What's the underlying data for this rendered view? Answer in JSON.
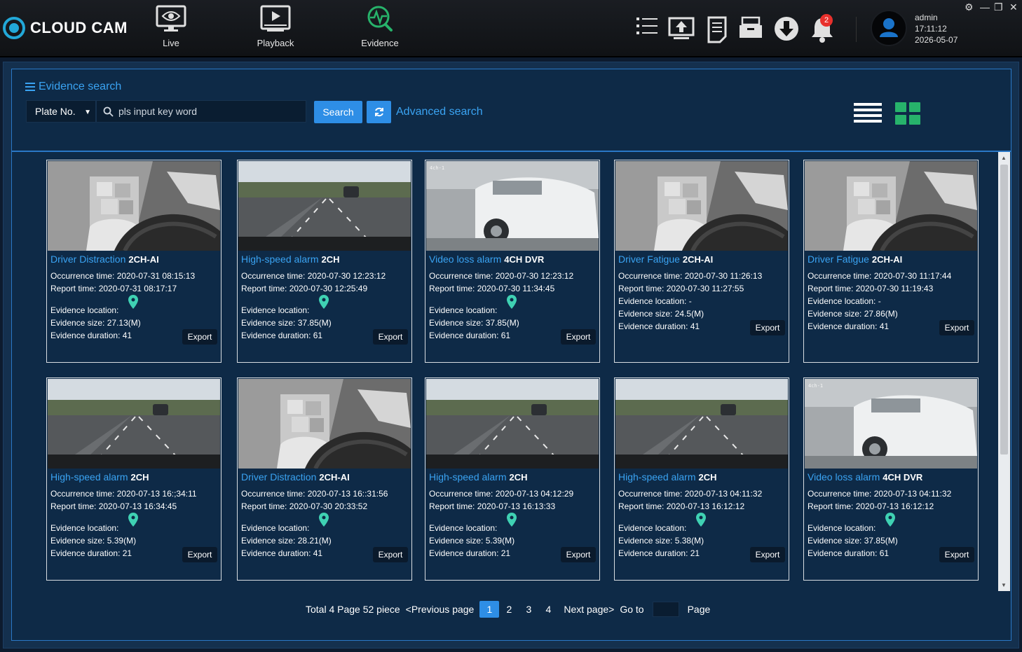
{
  "app": {
    "name": "CLOUD CAM",
    "nav": [
      {
        "label": "Live"
      },
      {
        "label": "Playback"
      },
      {
        "label": "Evidence"
      }
    ],
    "notifications_count": "2",
    "user": {
      "name": "admin",
      "time": "17:11:12",
      "date": "2026-05-07"
    },
    "accent_color": "#2e8ee6",
    "active_nav_color": "#27b36b"
  },
  "search": {
    "title": "Evidence search",
    "field_select": "Plate No.",
    "keyword_placeholder": "pls input key word",
    "search_label": "Search",
    "advanced_label": "Advanced search"
  },
  "labels": {
    "occurrence": "Occurrence time:",
    "report": "Report time:",
    "location": "Evidence location:",
    "size": "Evidence size:",
    "duration": "Evidence duration:",
    "export": "Export"
  },
  "cards": [
    {
      "type": "Driver Distraction",
      "channel": "2CH-AI",
      "occurrence": "2020-07-31 08:15:13",
      "report": "2020-07-31 08:17:17",
      "location": "",
      "size": "27.13(M)",
      "duration": "41",
      "image": "cabin"
    },
    {
      "type": "High-speed alarm",
      "channel": "2CH",
      "occurrence": "2020-07-30 12:23:12",
      "report": "2020-07-30 12:25:49",
      "location": "",
      "size": "37.85(M)",
      "duration": "61",
      "image": "road"
    },
    {
      "type": "Video loss alarm",
      "channel": "4CH DVR",
      "occurrence": "2020-07-30 12:23:12",
      "report": "2020-07-30  11:34:45",
      "location": "",
      "size": "37.85(M)",
      "duration": "61",
      "image": "dvr"
    },
    {
      "type": "Driver Fatigue",
      "channel": "2CH-AI",
      "occurrence": "2020-07-30 11:26:13",
      "report": "2020-07-30 11:27:55",
      "location": "-",
      "size": "24.5(M)",
      "duration": "41",
      "image": "cabin"
    },
    {
      "type": "Driver Fatigue",
      "channel": "2CH-AI",
      "occurrence": "2020-07-30 11:17:44",
      "report": "2020-07-30 11:19:43",
      "location": "-",
      "size": "27.86(M)",
      "duration": "41",
      "image": "cabin"
    },
    {
      "type": "High-speed alarm",
      "channel": "2CH",
      "occurrence": "2020-07-13 16:;34:11",
      "report": "2020-07-13 16:34:45",
      "location": "",
      "size": "5.39(M)",
      "duration": "21",
      "image": "road"
    },
    {
      "type": "Driver Distraction",
      "channel": "2CH-AI",
      "occurrence": "2020-07-13 16::31:56",
      "report": "2020-07-30 20:33:52",
      "location": "",
      "size": "28.21(M)",
      "duration": "41",
      "image": "cabin"
    },
    {
      "type": "High-speed alarm",
      "channel": "2CH",
      "occurrence": "2020-07-13 04:12:29",
      "report": "2020-07-13 16:13:33",
      "location": "",
      "size": "5.39(M)",
      "duration": "21",
      "image": "road"
    },
    {
      "type": "High-speed alarm",
      "channel": "2CH",
      "occurrence": "2020-07-13 04:11:32",
      "report": "2020-07-13 16:12:12",
      "location": "",
      "size": "5.38(M)",
      "duration": "21",
      "image": "road"
    },
    {
      "type": "Video loss alarm",
      "channel": "4CH DVR",
      "occurrence": "2020-07-13 04:11:32",
      "report": "2020-07-13 16:12:12",
      "location": "",
      "size": "37.85(M)",
      "duration": "61",
      "image": "dvr"
    }
  ],
  "pagination": {
    "total": "Total 4 Page 52 piece",
    "prev": "<Previous page",
    "pages": [
      "1",
      "2",
      "3",
      "4"
    ],
    "active_page": "1",
    "next": "Next page>",
    "goto": "Go to",
    "page_word": "Page"
  }
}
